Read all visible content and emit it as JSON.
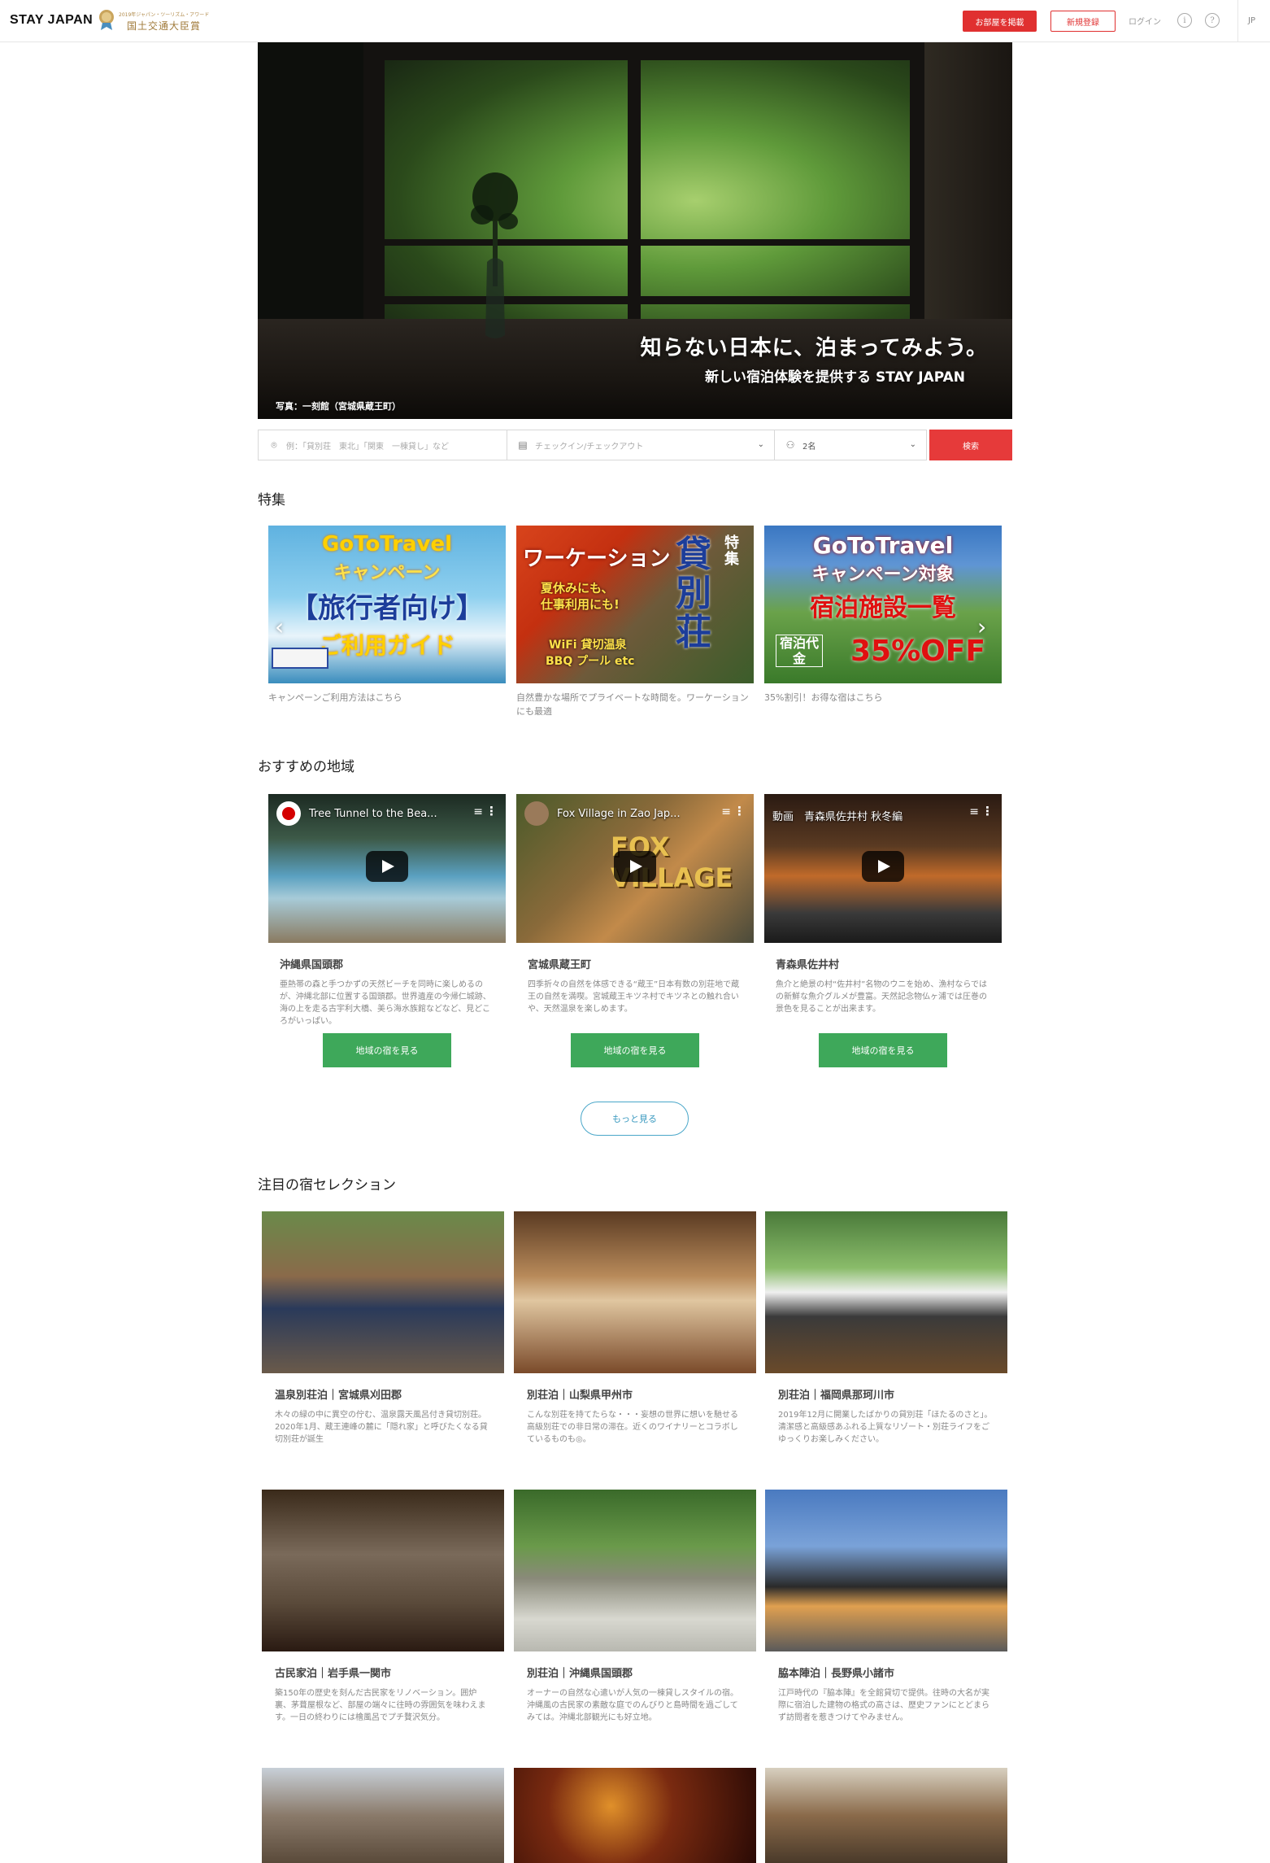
{
  "header": {
    "logo": "STAY JAPAN",
    "award_small": "2019年ジャパン・ツーリズム・アワード",
    "award_big": "国土交通大臣賞",
    "post_button": "お部屋を掲載",
    "signup_button": "新規登録",
    "login_link": "ログイン",
    "info_icon": "info-icon",
    "help_icon": "help-icon",
    "language": "JP"
  },
  "hero": {
    "headline": "知らない日本に、泊まってみよう。",
    "subheadline": "新しい宿泊体験を提供する STAY JAPAN",
    "credit": "写真：一刻館（宮城県蔵王町）"
  },
  "search": {
    "location_placeholder": "例：「貸別荘　東北」「関東　一棟貸し」など",
    "date_placeholder": "チェックイン/チェックアウト",
    "guests_value": "2名",
    "search_button": "検索"
  },
  "features": {
    "title": "特集",
    "items": [
      {
        "caption": "キャンペーンご利用方法はこちら",
        "line1": "GoToTravel",
        "line2": "キャンペーン",
        "line3": "【旅行者向け】",
        "line4": "ご利用ガイド"
      },
      {
        "caption": "自然豊かな場所でプライベートな時間を。ワーケーションにも最適",
        "line1": "ワーケーション",
        "line2": "夏休みにも、",
        "line3": "仕事利用にも!",
        "line4": "WiFi 貸切温泉",
        "line5": "BBQ プール etc",
        "tag": "特集",
        "vertical": "貸別荘"
      },
      {
        "caption": "35%割引！お得な宿はこちら",
        "line1": "GoToTravel",
        "line2": "キャンペーン対象",
        "line3": "宿泊施設一覧",
        "line4": "宿泊代金",
        "line5": "35%OFF"
      }
    ]
  },
  "regions": {
    "title": "おすすめの地域",
    "button_label": "地域の宿を見る",
    "more_button": "もっと見る",
    "items": [
      {
        "video_title": "Tree Tunnel to the Bea...",
        "name": "沖縄県国頭郡",
        "desc": "亜熱帯の森と手つかずの天然ビーチを同時に楽しめるのが、沖縄北部に位置する国頭郡。世界遺産の今帰仁城跡、海の上を走る古宇利大橋、美ら海水族館などなど、見どころがいっぱい。"
      },
      {
        "video_title": "Fox Village in Zao Jap...",
        "name": "宮城県蔵王町",
        "desc": "四季折々の自然を体感できる“蔵王”日本有数の別荘地で蔵王の自然を満喫。宮城蔵王キツネ村でキツネとの触れ合いや、天然温泉を楽しめます。",
        "overlay": "FOX VILLAGE"
      },
      {
        "video_title": "動画　青森県佐井村 秋冬編",
        "name": "青森県佐井村",
        "desc": "魚介と絶景の村“佐井村”名物のウニを始め、漁村ならではの新鮮な魚介グルメが豊富。天然記念物仏ヶ浦では圧巻の景色を見ることが出来ます。"
      }
    ]
  },
  "selection": {
    "title": "注目の宿セレクション",
    "items": [
      {
        "name": "温泉別荘泊｜宮城県刈田郡",
        "desc": "木々の緑の中に異空の佇む、温泉露天風呂付き貸切別荘。2020年1月、蔵王連峰の麓に「隠れ家」と呼びたくなる貸切別荘が誕生"
      },
      {
        "name": "別荘泊｜山梨県甲州市",
        "desc": "こんな別荘を持てたらな・・・妄想の世界に想いを馳せる高級別荘での非日常の滞在。近くのワイナリーとコラボしているものも◎。"
      },
      {
        "name": "別荘泊｜福岡県那珂川市",
        "desc": "2019年12月に開業したばかりの貸別荘「ほたるのさと」。清潔感と高級感あふれる上質なリゾート・別荘ライフをごゆっくりお楽しみください。"
      },
      {
        "name": "古民家泊｜岩手県一関市",
        "desc": "築150年の歴史を刻んだ古民家をリノベーション。囲炉裏、茅葺屋根など、部屋の端々に往時の雰囲気を味わえます。一日の終わりには檜風呂でプチ贅沢気分。"
      },
      {
        "name": "別荘泊｜沖縄県国頭郡",
        "desc": "オーナーの自然な心遣いが人気の一棟貸しスタイルの宿。沖縄風の古民家の素敵な庭でのんびりと島時間を過ごしてみては。沖縄北部観光にも好立地。"
      },
      {
        "name": "脇本陣泊｜長野県小諸市",
        "desc": "江戸時代の『脇本陣』を全館貸切で提供。往時の大名が実際に宿泊した建物の格式の高さは、歴史ファンにとどまらず訪問者を惹きつけてやみません。"
      }
    ]
  }
}
